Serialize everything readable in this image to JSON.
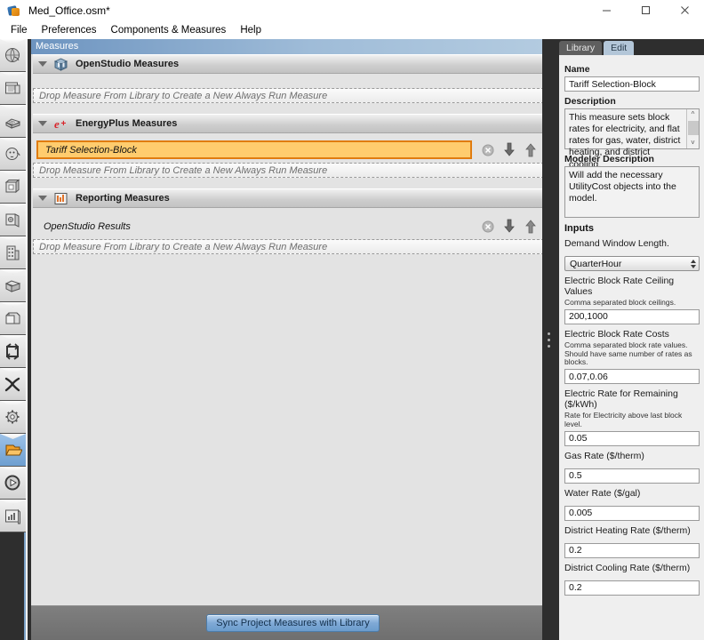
{
  "window": {
    "title": "Med_Office.osm*",
    "app_icon": "openstudio-icon",
    "minimize": "minimize-icon",
    "maximize": "maximize-icon",
    "close": "close-icon"
  },
  "menu": {
    "items": [
      {
        "label": "File"
      },
      {
        "label": "Preferences"
      },
      {
        "label": "Components & Measures"
      },
      {
        "label": "Help"
      }
    ]
  },
  "rail": {
    "items": [
      {
        "name": "site-icon",
        "selected": false
      },
      {
        "name": "schedules-icon",
        "selected": false
      },
      {
        "name": "constructions-icon",
        "selected": false
      },
      {
        "name": "loads-icon",
        "selected": false
      },
      {
        "name": "space-types-icon",
        "selected": false
      },
      {
        "name": "geometry-icon",
        "selected": false
      },
      {
        "name": "facility-icon",
        "selected": false
      },
      {
        "name": "spaces-icon",
        "selected": false
      },
      {
        "name": "thermal-zones-icon",
        "selected": false
      },
      {
        "name": "hvac-systems-icon",
        "selected": false
      },
      {
        "name": "variables-icon",
        "selected": false
      },
      {
        "name": "simulation-settings-icon",
        "selected": false
      },
      {
        "name": "measures-icon",
        "selected": true
      },
      {
        "name": "run-simulation-icon",
        "selected": false
      },
      {
        "name": "results-summary-icon",
        "selected": false
      }
    ]
  },
  "main": {
    "header_title": "Measures",
    "groups": [
      {
        "icon": "openstudio-measures-icon",
        "label": "OpenStudio Measures",
        "measures": [],
        "dropzone": "Drop Measure From Library to Create a New Always Run Measure"
      },
      {
        "icon": "energyplus-measures-icon",
        "label": "EnergyPlus Measures",
        "measures": [
          {
            "name": "Tariff Selection-Block",
            "selected": true,
            "remove_icon": "remove-circle-icon",
            "move_down_icon": "arrow-down-icon",
            "move_up_icon": "arrow-up-icon"
          }
        ],
        "dropzone": "Drop Measure From Library to Create a New Always Run Measure"
      },
      {
        "icon": "reporting-measures-icon",
        "label": "Reporting Measures",
        "measures": [
          {
            "name": "OpenStudio Results",
            "selected": false,
            "remove_icon": "remove-circle-icon",
            "move_down_icon": "arrow-down-icon",
            "move_up_icon": "arrow-up-icon"
          }
        ],
        "dropzone": "Drop Measure From Library to Create a New Always Run Measure"
      }
    ],
    "sync_button": "Sync Project Measures with Library"
  },
  "right": {
    "tabs": [
      {
        "label": "Library",
        "active": false
      },
      {
        "label": "Edit",
        "active": true
      }
    ],
    "name_label": "Name",
    "name_value": "Tariff Selection-Block",
    "description_label": "Description",
    "description_value": "This measure sets block rates for electricity, and flat rates for gas, water, district heating, and district cooling.",
    "modeler_description_label": "Modeler Description",
    "modeler_description_value": "Will add the necessary UtilityCost objects into the model.",
    "inputs_label": "Inputs",
    "fields": [
      {
        "label": "Demand Window Length.",
        "hint": "",
        "type": "combo",
        "value": "QuarterHour"
      },
      {
        "label": "Electric Block Rate Ceiling Values",
        "hint": "Comma separated block ceilings.",
        "type": "text",
        "value": "200,1000"
      },
      {
        "label": "Electric Block Rate Costs",
        "hint": "Comma separated block rate values. Should have same number of rates as blocks.",
        "type": "text",
        "value": "0.07,0.06"
      },
      {
        "label": "Electric Rate for Remaining ($/kWh)",
        "hint": "Rate for Electricity above last block level.",
        "type": "text",
        "value": "0.05"
      },
      {
        "label": "Gas Rate ($/therm)",
        "hint": "",
        "type": "text",
        "value": "0.5"
      },
      {
        "label": "Water Rate ($/gal)",
        "hint": "",
        "type": "text",
        "value": "0.005"
      },
      {
        "label": "District Heating Rate ($/therm)",
        "hint": "",
        "type": "text",
        "value": "0.2"
      },
      {
        "label": "District Cooling Rate ($/therm)",
        "hint": "",
        "type": "text",
        "value": "0.2"
      }
    ]
  },
  "colors": {
    "selection_orange": "#ffcc6e",
    "selection_border": "#e07c10",
    "header_blue": "#7ba1c6",
    "dark_chrome": "#2e2e2e",
    "panel_bg": "#e3e3e3",
    "accent_button": "#7fa9d6"
  }
}
